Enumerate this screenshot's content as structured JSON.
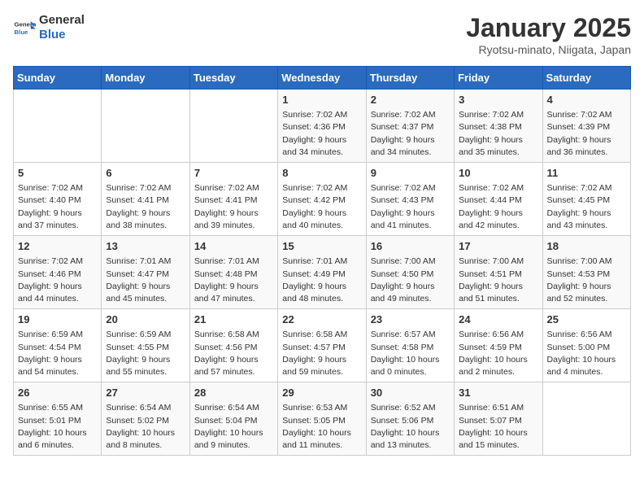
{
  "header": {
    "logo_general": "General",
    "logo_blue": "Blue",
    "title": "January 2025",
    "subtitle": "Ryotsu-minato, Niigata, Japan"
  },
  "weekdays": [
    "Sunday",
    "Monday",
    "Tuesday",
    "Wednesday",
    "Thursday",
    "Friday",
    "Saturday"
  ],
  "weeks": [
    [
      {
        "day": "",
        "info": ""
      },
      {
        "day": "",
        "info": ""
      },
      {
        "day": "",
        "info": ""
      },
      {
        "day": "1",
        "info": "Sunrise: 7:02 AM\nSunset: 4:36 PM\nDaylight: 9 hours\nand 34 minutes."
      },
      {
        "day": "2",
        "info": "Sunrise: 7:02 AM\nSunset: 4:37 PM\nDaylight: 9 hours\nand 34 minutes."
      },
      {
        "day": "3",
        "info": "Sunrise: 7:02 AM\nSunset: 4:38 PM\nDaylight: 9 hours\nand 35 minutes."
      },
      {
        "day": "4",
        "info": "Sunrise: 7:02 AM\nSunset: 4:39 PM\nDaylight: 9 hours\nand 36 minutes."
      }
    ],
    [
      {
        "day": "5",
        "info": "Sunrise: 7:02 AM\nSunset: 4:40 PM\nDaylight: 9 hours\nand 37 minutes."
      },
      {
        "day": "6",
        "info": "Sunrise: 7:02 AM\nSunset: 4:41 PM\nDaylight: 9 hours\nand 38 minutes."
      },
      {
        "day": "7",
        "info": "Sunrise: 7:02 AM\nSunset: 4:41 PM\nDaylight: 9 hours\nand 39 minutes."
      },
      {
        "day": "8",
        "info": "Sunrise: 7:02 AM\nSunset: 4:42 PM\nDaylight: 9 hours\nand 40 minutes."
      },
      {
        "day": "9",
        "info": "Sunrise: 7:02 AM\nSunset: 4:43 PM\nDaylight: 9 hours\nand 41 minutes."
      },
      {
        "day": "10",
        "info": "Sunrise: 7:02 AM\nSunset: 4:44 PM\nDaylight: 9 hours\nand 42 minutes."
      },
      {
        "day": "11",
        "info": "Sunrise: 7:02 AM\nSunset: 4:45 PM\nDaylight: 9 hours\nand 43 minutes."
      }
    ],
    [
      {
        "day": "12",
        "info": "Sunrise: 7:02 AM\nSunset: 4:46 PM\nDaylight: 9 hours\nand 44 minutes."
      },
      {
        "day": "13",
        "info": "Sunrise: 7:01 AM\nSunset: 4:47 PM\nDaylight: 9 hours\nand 45 minutes."
      },
      {
        "day": "14",
        "info": "Sunrise: 7:01 AM\nSunset: 4:48 PM\nDaylight: 9 hours\nand 47 minutes."
      },
      {
        "day": "15",
        "info": "Sunrise: 7:01 AM\nSunset: 4:49 PM\nDaylight: 9 hours\nand 48 minutes."
      },
      {
        "day": "16",
        "info": "Sunrise: 7:00 AM\nSunset: 4:50 PM\nDaylight: 9 hours\nand 49 minutes."
      },
      {
        "day": "17",
        "info": "Sunrise: 7:00 AM\nSunset: 4:51 PM\nDaylight: 9 hours\nand 51 minutes."
      },
      {
        "day": "18",
        "info": "Sunrise: 7:00 AM\nSunset: 4:53 PM\nDaylight: 9 hours\nand 52 minutes."
      }
    ],
    [
      {
        "day": "19",
        "info": "Sunrise: 6:59 AM\nSunset: 4:54 PM\nDaylight: 9 hours\nand 54 minutes."
      },
      {
        "day": "20",
        "info": "Sunrise: 6:59 AM\nSunset: 4:55 PM\nDaylight: 9 hours\nand 55 minutes."
      },
      {
        "day": "21",
        "info": "Sunrise: 6:58 AM\nSunset: 4:56 PM\nDaylight: 9 hours\nand 57 minutes."
      },
      {
        "day": "22",
        "info": "Sunrise: 6:58 AM\nSunset: 4:57 PM\nDaylight: 9 hours\nand 59 minutes."
      },
      {
        "day": "23",
        "info": "Sunrise: 6:57 AM\nSunset: 4:58 PM\nDaylight: 10 hours\nand 0 minutes."
      },
      {
        "day": "24",
        "info": "Sunrise: 6:56 AM\nSunset: 4:59 PM\nDaylight: 10 hours\nand 2 minutes."
      },
      {
        "day": "25",
        "info": "Sunrise: 6:56 AM\nSunset: 5:00 PM\nDaylight: 10 hours\nand 4 minutes."
      }
    ],
    [
      {
        "day": "26",
        "info": "Sunrise: 6:55 AM\nSunset: 5:01 PM\nDaylight: 10 hours\nand 6 minutes."
      },
      {
        "day": "27",
        "info": "Sunrise: 6:54 AM\nSunset: 5:02 PM\nDaylight: 10 hours\nand 8 minutes."
      },
      {
        "day": "28",
        "info": "Sunrise: 6:54 AM\nSunset: 5:04 PM\nDaylight: 10 hours\nand 9 minutes."
      },
      {
        "day": "29",
        "info": "Sunrise: 6:53 AM\nSunset: 5:05 PM\nDaylight: 10 hours\nand 11 minutes."
      },
      {
        "day": "30",
        "info": "Sunrise: 6:52 AM\nSunset: 5:06 PM\nDaylight: 10 hours\nand 13 minutes."
      },
      {
        "day": "31",
        "info": "Sunrise: 6:51 AM\nSunset: 5:07 PM\nDaylight: 10 hours\nand 15 minutes."
      },
      {
        "day": "",
        "info": ""
      }
    ]
  ]
}
